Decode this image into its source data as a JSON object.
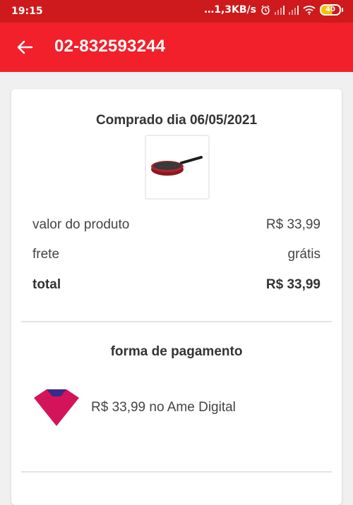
{
  "status_bar": {
    "time": "19:15",
    "net_speed": "…1,3KB/s",
    "battery": "40",
    "icons": [
      "alarm-icon",
      "signal-icon",
      "signal-icon",
      "wifi-icon",
      "battery-icon"
    ]
  },
  "app_bar": {
    "title": "02-832593244",
    "back_icon": "arrow-left-icon",
    "color": "#f1202a"
  },
  "order": {
    "purchased_label": "Comprado dia 06/05/2021",
    "product_image": "frying-pan",
    "rows": [
      {
        "label": "valor do produto",
        "value": "R$ 33,99"
      },
      {
        "label": "frete",
        "value": "grátis"
      },
      {
        "label": "total",
        "value": "R$ 33,99"
      }
    ]
  },
  "payment": {
    "title": "forma de pagamento",
    "logo": "ame-digital-logo",
    "text": "R$ 33,99 no Ame Digital"
  }
}
